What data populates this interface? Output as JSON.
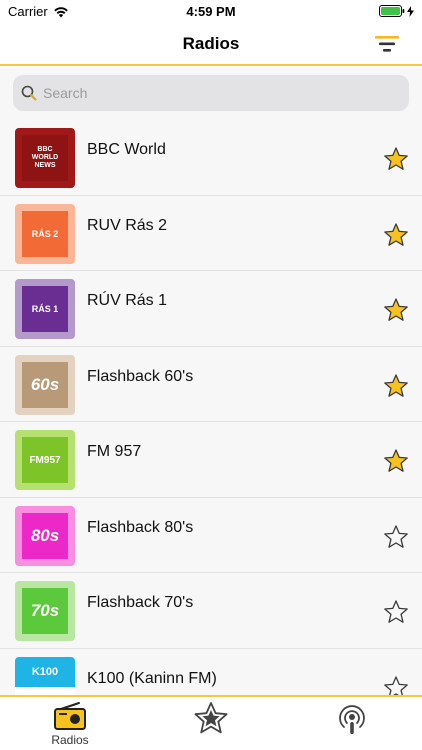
{
  "status": {
    "carrier": "Carrier",
    "time": "4:59 PM"
  },
  "nav": {
    "title": "Radios"
  },
  "search": {
    "placeholder": "Search"
  },
  "stations": [
    {
      "name": "BBC World",
      "logo_text": "BBC\nWORLD\nNEWS",
      "favorite": true,
      "logo_bg": "#a01818",
      "logo_inner": "#8e1414"
    },
    {
      "name": "RUV Rás 2",
      "logo_text": "RÁS 2",
      "favorite": true,
      "logo_bg": "#f9b698",
      "logo_inner": "#f26b36"
    },
    {
      "name": "RÚV Rás 1",
      "logo_text": "RÁS 1",
      "favorite": true,
      "logo_bg": "#b39acb",
      "logo_inner": "#6a2d91"
    },
    {
      "name": "Flashback 60's",
      "logo_text": "60s",
      "favorite": true,
      "logo_bg": "#e3d2c0",
      "logo_inner": "#b89a79"
    },
    {
      "name": "FM 957",
      "logo_text": "FM957",
      "favorite": true,
      "logo_bg": "#b6e070",
      "logo_inner": "#7dc428"
    },
    {
      "name": "Flashback 80's",
      "logo_text": "80s",
      "favorite": false,
      "logo_bg": "#f78ee0",
      "logo_inner": "#ec28c8"
    },
    {
      "name": "Flashback 70's",
      "logo_text": "70s",
      "favorite": false,
      "logo_bg": "#b9e6a3",
      "logo_inner": "#5cc83c"
    },
    {
      "name": "K100 (Kaninn FM)",
      "logo_text": "K100",
      "favorite": false,
      "logo_bg": "#ffffff",
      "logo_inner": "#1eb4e6"
    }
  ],
  "tabs": [
    {
      "label": "Radios",
      "icon": "radio-icon",
      "active": true
    },
    {
      "label": "",
      "icon": "favorites-star-icon",
      "active": false
    },
    {
      "label": "",
      "icon": "podcast-icon",
      "active": false
    }
  ],
  "colors": {
    "accent": "#f6c83c",
    "star_fill": "#f6c31e",
    "star_stroke": "#3a3a3a"
  }
}
